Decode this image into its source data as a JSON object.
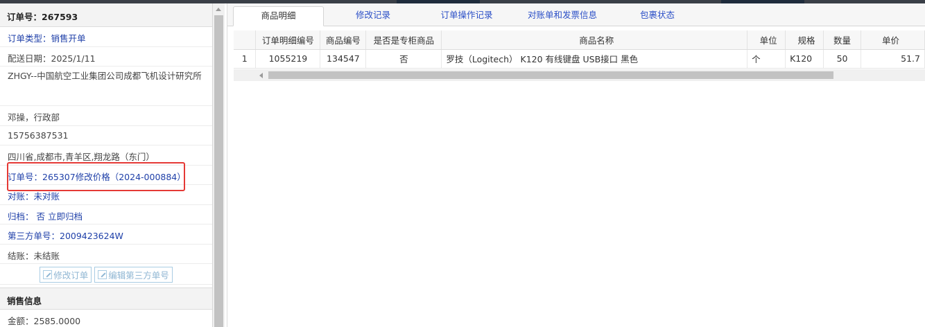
{
  "order_info": {
    "header": "订单号：267593",
    "order_type": "订单类型：销售开单",
    "delivery_date": "配送日期：2025/1/11",
    "customer": "ZHGY--中国航空工业集团公司成都飞机设计研究所",
    "contact": "邓操，行政部",
    "phone": "15756387531",
    "address": "四川省,成都市,青羊区,翔龙路（东门）",
    "linked_order": "订单号：265307修改价格（2024-000884）",
    "reconcile": "对账：未对账",
    "archive_label": "归档：",
    "archive_value": "否",
    "archive_action": "立即归档",
    "third_party_no": "第三方单号：2009423624W",
    "settle": "结账：未结账",
    "edit_order_button": "修改订单",
    "edit_third_party_button": "编辑第三方单号"
  },
  "sales_info": {
    "header": "销售信息",
    "amount": "金额：2585.0000"
  },
  "tabs": [
    "商品明细",
    "修改记录",
    "订单操作记录",
    "对账单和发票信息",
    "包裹状态"
  ],
  "grid": {
    "columns": [
      "",
      "订单明细编号",
      "商品编号",
      "是否是专柜商品",
      "商品名称",
      "单位",
      "规格",
      "数量",
      "单价"
    ],
    "rows": [
      {
        "index": "1",
        "detail_no": "1055219",
        "product_no": "134547",
        "counter": "否",
        "name": "罗技（Logitech） K120 有线键盘 USB接口 黑色",
        "unit": "个",
        "spec": "K120",
        "qty": "50",
        "price": "51.7"
      }
    ]
  },
  "colors": {
    "link": "#1e3fa8",
    "highlight_box": "#e53935"
  }
}
